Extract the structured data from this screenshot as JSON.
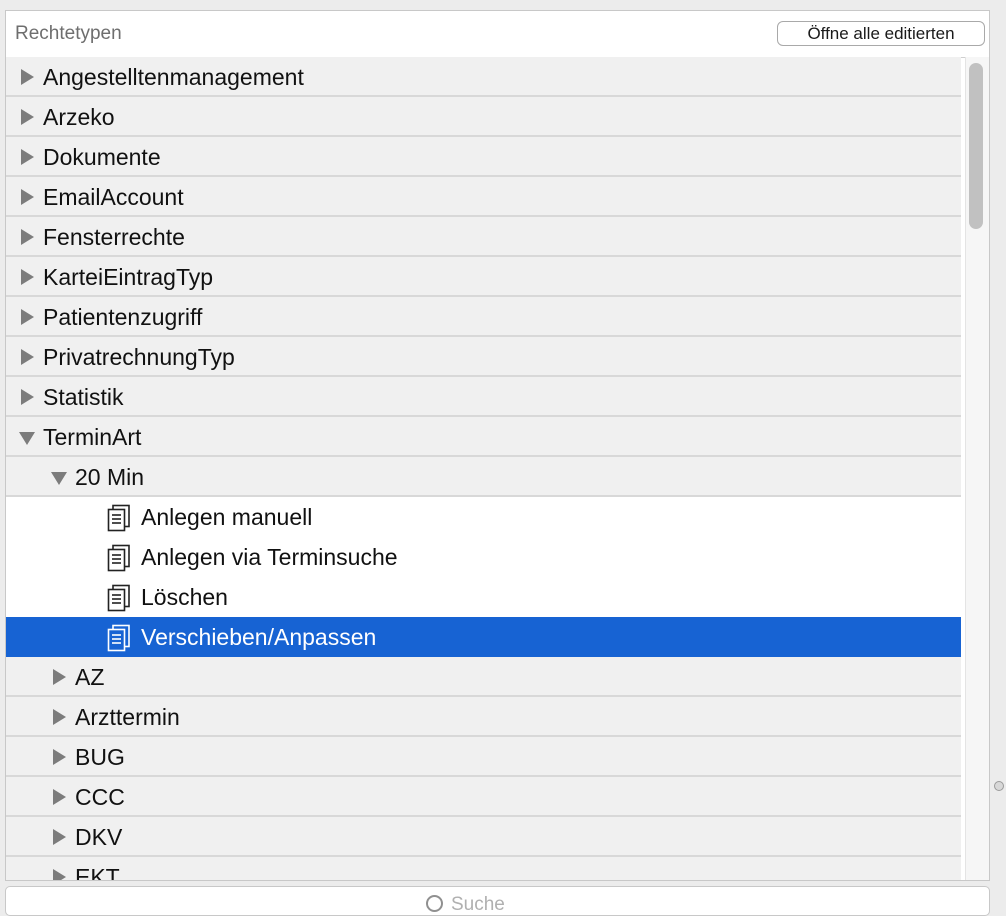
{
  "header": {
    "title": "Rechtetypen",
    "open_all_label": "Öffne alle editierten"
  },
  "tree": {
    "items": [
      {
        "label": "Angestelltenmanagement",
        "level": 0,
        "kind": "group",
        "state": "collapsed"
      },
      {
        "label": "Arzeko",
        "level": 0,
        "kind": "group",
        "state": "collapsed"
      },
      {
        "label": "Dokumente",
        "level": 0,
        "kind": "group",
        "state": "collapsed"
      },
      {
        "label": "EmailAccount",
        "level": 0,
        "kind": "group",
        "state": "collapsed"
      },
      {
        "label": "Fensterrechte",
        "level": 0,
        "kind": "group",
        "state": "collapsed"
      },
      {
        "label": "KarteiEintragTyp",
        "level": 0,
        "kind": "group",
        "state": "collapsed"
      },
      {
        "label": "Patientenzugriff",
        "level": 0,
        "kind": "group",
        "state": "collapsed"
      },
      {
        "label": "PrivatrechnungTyp",
        "level": 0,
        "kind": "group",
        "state": "collapsed"
      },
      {
        "label": "Statistik",
        "level": 0,
        "kind": "group",
        "state": "collapsed"
      },
      {
        "label": "TerminArt",
        "level": 0,
        "kind": "group",
        "state": "expanded"
      },
      {
        "label": "20 Min",
        "level": 1,
        "kind": "group",
        "state": "expanded"
      },
      {
        "label": "Anlegen manuell",
        "level": 2,
        "kind": "leaf",
        "state": "none"
      },
      {
        "label": "Anlegen via Terminsuche",
        "level": 2,
        "kind": "leaf",
        "state": "none"
      },
      {
        "label": "Löschen",
        "level": 2,
        "kind": "leaf",
        "state": "none"
      },
      {
        "label": "Verschieben/Anpassen",
        "level": 2,
        "kind": "leaf",
        "state": "selected"
      },
      {
        "label": "AZ",
        "level": 1,
        "kind": "group",
        "state": "collapsed"
      },
      {
        "label": "Arzttermin",
        "level": 1,
        "kind": "group",
        "state": "collapsed"
      },
      {
        "label": "BUG",
        "level": 1,
        "kind": "group",
        "state": "collapsed"
      },
      {
        "label": "CCC",
        "level": 1,
        "kind": "group",
        "state": "collapsed"
      },
      {
        "label": "DKV",
        "level": 1,
        "kind": "group",
        "state": "collapsed"
      },
      {
        "label": "EKT",
        "level": 1,
        "kind": "group",
        "state": "collapsed"
      }
    ]
  },
  "search": {
    "placeholder": "Suche"
  },
  "colors": {
    "selection": "#1763d3",
    "group_row": "#f0f0f0",
    "disclosure": "#7c7c7c"
  }
}
